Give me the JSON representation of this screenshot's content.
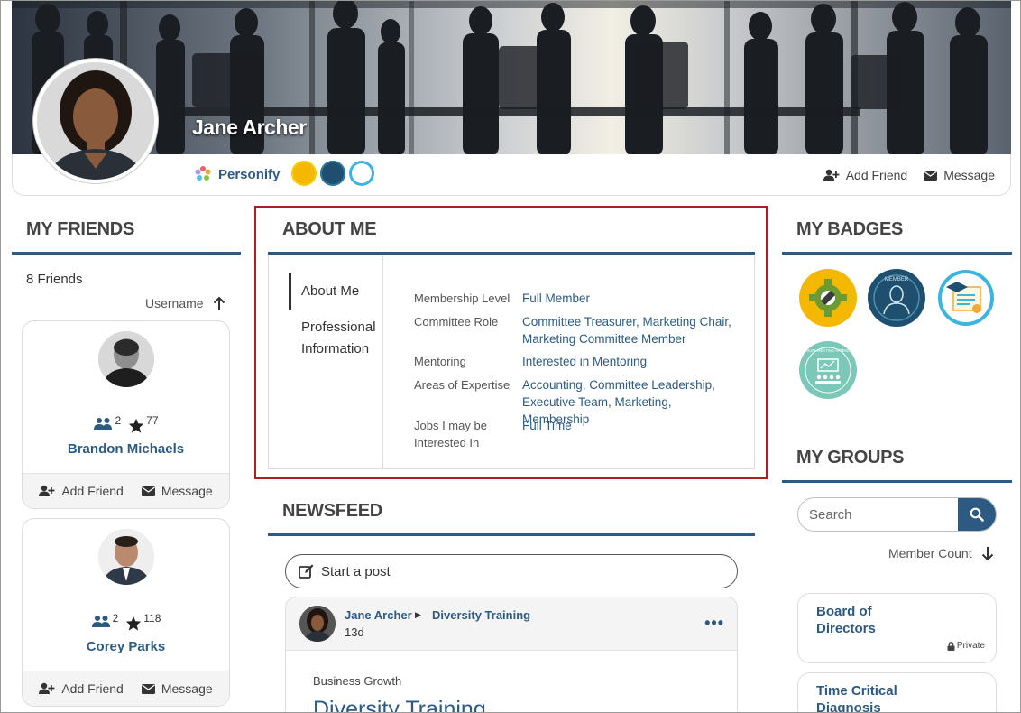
{
  "profile": {
    "name": "Jane Archer",
    "org_label": "Personify",
    "add_friend": "Add Friend",
    "message": "Message"
  },
  "friends": {
    "title": "MY FRIENDS",
    "count_label": "8 Friends",
    "sort_label": "Username",
    "items": [
      {
        "name": "Brandon Michaels",
        "mutual": "2",
        "points": "77",
        "add_friend": "Add Friend",
        "message": "Message"
      },
      {
        "name": "Corey Parks",
        "mutual": "2",
        "points": "118",
        "add_friend": "Add Friend",
        "message": "Message"
      }
    ]
  },
  "about": {
    "title": "ABOUT ME",
    "nav": [
      "About Me",
      "Professional Information"
    ],
    "fields": [
      {
        "label": "Membership Level",
        "value": "Full Member"
      },
      {
        "label": "Committee Role",
        "value": "Committee Treasurer, Marketing Chair, Marketing Committee Member"
      },
      {
        "label": "Mentoring",
        "value": "Interested in Mentoring"
      },
      {
        "label": "Areas of Expertise",
        "value": "Accounting, Committee Leadership, Executive Team, Marketing, Membership"
      },
      {
        "label": "Jobs I may be Interested In",
        "value": "Full Time"
      }
    ]
  },
  "newsfeed": {
    "title": "NEWSFEED",
    "start_post": "Start a post",
    "post": {
      "author": "Jane Archer",
      "group": "Diversity Training",
      "time": "13d",
      "category": "Business Growth",
      "title": "Diversity Training"
    }
  },
  "badges": {
    "title": "MY BADGES",
    "items": [
      "settings-gear-badge",
      "member-badge",
      "graduation-certificate-badge",
      "annual-meeting-attendee-badge"
    ],
    "member_text": "MEMBER",
    "annual_text": "ANNUAL MEETING ATTENDEE"
  },
  "groups": {
    "title": "MY GROUPS",
    "search_placeholder": "Search",
    "sort_label": "Member Count",
    "items": [
      {
        "name": "Board of Directors",
        "privacy": "Private"
      },
      {
        "name": "Time Critical Diagnosis",
        "privacy": ""
      }
    ]
  },
  "colors": {
    "accent": "#2d5a82",
    "highlight_outline": "#b01c24"
  }
}
